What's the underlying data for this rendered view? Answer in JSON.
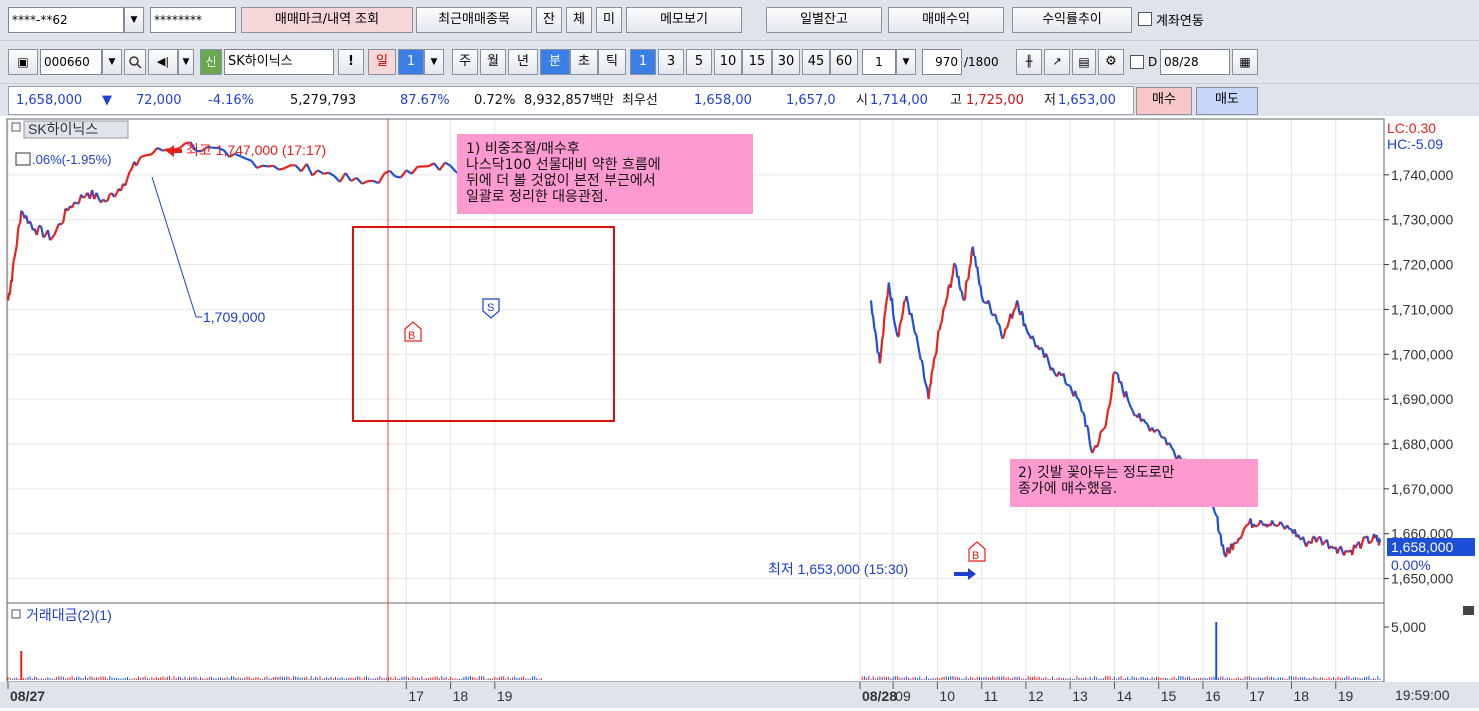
{
  "toolbar1": {
    "account_masked": "****-**62",
    "password_masked": "********",
    "btn_trade_mark": "매매마크/내역 조회",
    "btn_recent": "최근매매종목",
    "btn_jan": "잔",
    "btn_che": "체",
    "btn_mi": "미",
    "btn_memo": "메모보기",
    "btn_daily_balance": "일별잔고",
    "btn_trade_profit": "매매수익",
    "btn_return_trend": "수익률추이",
    "account_link_label": "계좌연동"
  },
  "toolbar2": {
    "stock_code": "000660",
    "new_badge": "신",
    "stock_name": "SK하이닉스",
    "warn": "!",
    "period_day": "일",
    "period_day_value": "1",
    "period_week": "주",
    "period_month": "월",
    "period_year": "년",
    "period_min": "분",
    "period_sec": "초",
    "period_tick": "틱",
    "intervals": [
      "1",
      "3",
      "5",
      "10",
      "15",
      "30",
      "45",
      "60"
    ],
    "interval_value": "1",
    "count_value": "970",
    "count_total": "/1800",
    "d_label": "D",
    "date_value": "08/28"
  },
  "quote": {
    "price": "1,658,000",
    "change_arrow": "▼",
    "change": "72,000",
    "change_pct": "-4.16%",
    "volume": "5,279,793",
    "vol_ratio": "87.67%",
    "turnover": "0.72%",
    "amount": "8,932,857백만",
    "best_label": "최우선",
    "best_ask": "1,658,00",
    "best_bid": "1,657,0",
    "open_label": "시",
    "open": "1,714,00",
    "high_label": "고",
    "high": "1,725,00",
    "low_label": "저",
    "low": "1,653,00",
    "buy_btn": "매수",
    "sell_btn": "매도"
  },
  "chart": {
    "legend_stock": "SK하이닉스",
    "legend_change": ".06%(-1.95%)",
    "lc": "LC:0.30",
    "hc": "HC:-5.09",
    "high_marker": "최고 1,747,000 (17:17)",
    "low_marker": "최저 1,653,000 (15:30)",
    "pointer_label": "1,709,000",
    "note1": "1) 비중조절/매수후\n나스닥100 선물대비 약한 흐름에\n뒤에 더 볼 것없이 본전 부근에서\n일괄로 정리한 대응관점.",
    "note2": "2) 깃발 꽂아두는 정도로만\n종가에 매수했음.",
    "current_price": "1,658,000",
    "current_pct": "0.00%",
    "volume_panel_label": "거래대금(2)(1)",
    "volume_axis": "5,000",
    "time_readout": "19:59:00",
    "marker_b": "B",
    "marker_s": "S",
    "colors": {
      "up": "#e8201c",
      "down": "#1b4fd8",
      "annot_box": "#ff9ad0",
      "highlight": "#d81010"
    }
  },
  "chart_data": {
    "type": "line",
    "title": "",
    "ylim": [
      1645000,
      1752000
    ],
    "y_ticks": [
      "1,740,000",
      "1,730,000",
      "1,720,000",
      "1,710,000",
      "1,700,000",
      "1,690,000",
      "1,680,000",
      "1,670,000",
      "1,660,000",
      "1,650,000"
    ],
    "y_tick_values": [
      1740000,
      1730000,
      1720000,
      1710000,
      1700000,
      1690000,
      1680000,
      1670000,
      1660000,
      1650000
    ],
    "x_ticks": [
      "08/27",
      "17",
      "18",
      "19",
      "08/28",
      "09",
      "10",
      "11",
      "12",
      "13",
      "14",
      "15",
      "16",
      "17",
      "18",
      "19"
    ],
    "x_tick_times": [
      8.0,
      17.0,
      18.0,
      19.0,
      27.25,
      28.0,
      29.0,
      30.0,
      31.0,
      32.0,
      33.0,
      34.0,
      35.0,
      36.0,
      37.0,
      38.0
    ],
    "x_tick_bold": [
      true,
      false,
      false,
      false,
      true,
      false,
      false,
      false,
      false,
      false,
      false,
      false,
      false,
      false,
      false,
      false
    ],
    "x_range": [
      8.0,
      39.0
    ],
    "series": [
      {
        "points": [
          [
            8.0,
            1712000
          ],
          [
            8.1,
            1718000
          ],
          [
            8.3,
            1732000
          ],
          [
            8.6,
            1728000
          ],
          [
            9.0,
            1726000
          ],
          [
            9.4,
            1733000
          ],
          [
            9.8,
            1736000
          ],
          [
            10.2,
            1734000
          ],
          [
            10.6,
            1738000
          ],
          [
            11.0,
            1744000
          ],
          [
            12.0,
            1747000
          ],
          [
            13.0,
            1744000
          ],
          [
            14.0,
            1742000
          ],
          [
            15.0,
            1741000
          ],
          [
            16.0,
            1738000
          ],
          [
            17.0,
            1741000
          ],
          [
            18.0,
            1742000
          ],
          [
            19.0,
            1738000
          ],
          [
            19.6,
            1740000
          ],
          [
            20.0,
            1741000
          ],
          [
            27.5,
            1712000
          ],
          [
            27.7,
            1698000
          ],
          [
            27.9,
            1716000
          ],
          [
            28.1,
            1704000
          ],
          [
            28.3,
            1713000
          ],
          [
            28.6,
            1700000
          ],
          [
            28.8,
            1690000
          ],
          [
            29.0,
            1703000
          ],
          [
            29.2,
            1712000
          ],
          [
            29.4,
            1720000
          ],
          [
            29.6,
            1712000
          ],
          [
            29.8,
            1724000
          ],
          [
            30.0,
            1713000
          ],
          [
            30.3,
            1709000
          ],
          [
            30.5,
            1704000
          ],
          [
            30.8,
            1712000
          ],
          [
            31.0,
            1706000
          ],
          [
            31.3,
            1701000
          ],
          [
            31.6,
            1697000
          ],
          [
            32.0,
            1693000
          ],
          [
            32.3,
            1687000
          ],
          [
            32.5,
            1678000
          ],
          [
            32.8,
            1684000
          ],
          [
            33.0,
            1696000
          ],
          [
            33.3,
            1690000
          ],
          [
            33.6,
            1685000
          ],
          [
            34.0,
            1683000
          ],
          [
            34.3,
            1679000
          ],
          [
            34.6,
            1676000
          ],
          [
            35.0,
            1670000
          ],
          [
            35.3,
            1664000
          ],
          [
            35.5,
            1655000
          ],
          [
            35.7,
            1658000
          ],
          [
            36.0,
            1662000
          ],
          [
            36.3,
            1663000
          ],
          [
            36.6,
            1662000
          ],
          [
            37.0,
            1661000
          ],
          [
            37.3,
            1658000
          ],
          [
            37.6,
            1659000
          ],
          [
            38.0,
            1657000
          ],
          [
            38.3,
            1656000
          ],
          [
            38.6,
            1658000
          ],
          [
            38.9,
            1659000
          ],
          [
            39.0,
            1658000
          ]
        ]
      }
    ],
    "volume_spikes": [
      [
        8.3,
        0.5
      ],
      [
        35.3,
        1.0
      ]
    ]
  }
}
